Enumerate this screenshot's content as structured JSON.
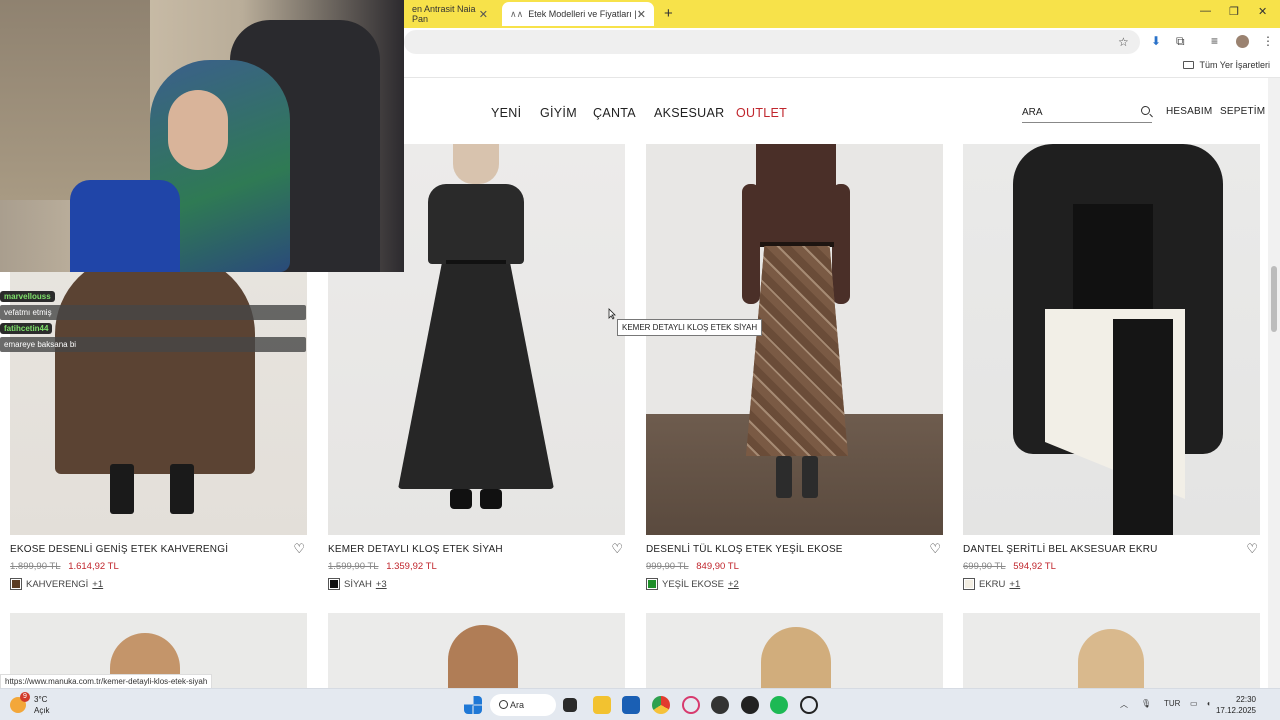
{
  "browser": {
    "tabs": [
      {
        "title": "en Antrasit Naia Pan",
        "active": false
      },
      {
        "title": "Etek Modelleri ve Fiyatları | Ma",
        "active": true
      }
    ],
    "bookmarks_label": "Tüm Yer İşaretleri"
  },
  "site": {
    "nav": [
      "YENİ",
      "GİYİM",
      "ÇANTA",
      "AKSESUAR",
      "OUTLET"
    ],
    "search_placeholder": "ARA",
    "account_label": "HESABIM",
    "cart_label": "SEPETİM",
    "tooltip": "KEMER DETAYLI KLOŞ ETEK SİYAH",
    "products": [
      {
        "name": "EKOSE DESENLİ GENİŞ ETEK KAHVERENGİ",
        "old_price": "1.899,90 TL",
        "price": "1.614,92 TL",
        "color_name": "KAHVERENGİ",
        "more": "+1",
        "swatch": "#5a3b22"
      },
      {
        "name": "KEMER DETAYLI KLOŞ ETEK SİYAH",
        "old_price": "1.599,90 TL",
        "price": "1.359,92 TL",
        "color_name": "SİYAH",
        "more": "+3",
        "swatch": "#111111"
      },
      {
        "name": "DESENLİ TÜL KLOŞ ETEK YEŞİL EKOSE",
        "old_price": "999,90 TL",
        "price": "849,90 TL",
        "color_name": "YEŞİL EKOSE",
        "more": "+2",
        "swatch": "#1f8f2a"
      },
      {
        "name": "DANTEL ŞERİTLİ BEL AKSESUAR EKRU",
        "old_price": "699,90 TL",
        "price": "594,92 TL",
        "color_name": "EKRU",
        "more": "+1",
        "swatch": "#f3eee2"
      }
    ]
  },
  "stream_chat": [
    {
      "user": "marvellouss",
      "message": "vefatmı etmiş"
    },
    {
      "user": "fatihcetin44",
      "message": "emareye baksana bi"
    }
  ],
  "status_url": "https://www.manuka.com.tr/kemer-detayli-klos-etek-siyah",
  "taskbar": {
    "weather_temp": "3°C",
    "weather_desc": "Açık",
    "weather_badge": "9",
    "search_label": "Ara",
    "lang": "TUR",
    "time": "22:30",
    "date": "17.12.2025"
  }
}
